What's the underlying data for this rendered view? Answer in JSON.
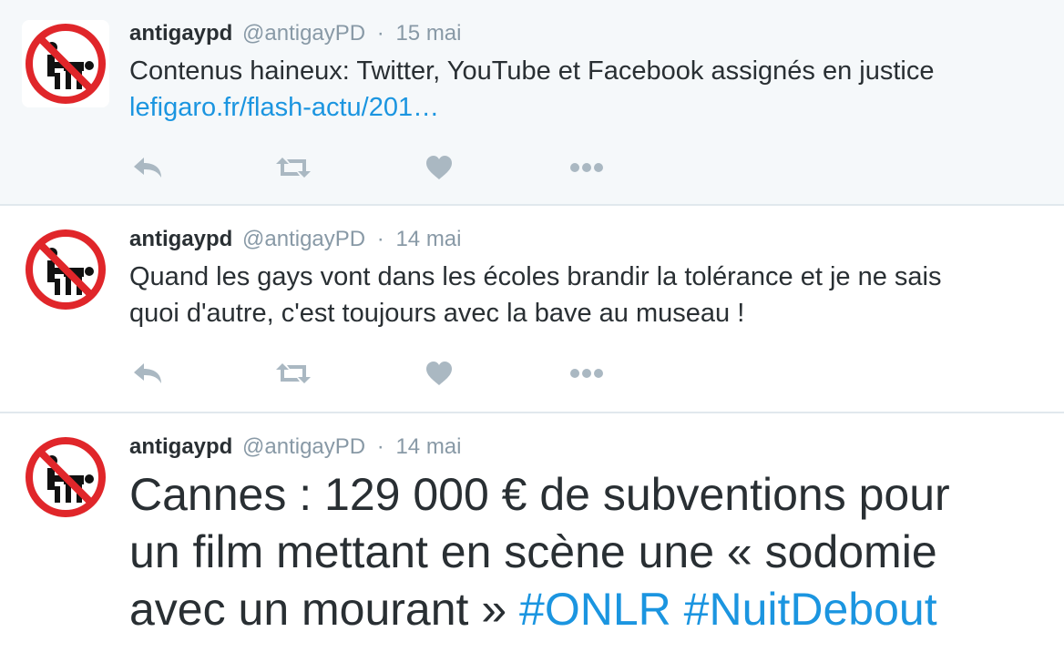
{
  "tweets": [
    {
      "fullname": "antigaypd",
      "username": "@antigayPD",
      "separator": "·",
      "time": "15 mai",
      "text": "Contenus haineux: Twitter, YouTube et Facebook assignés en justice",
      "link": "lefigaro.fr/flash-actu/201…"
    },
    {
      "fullname": "antigaypd",
      "username": "@antigayPD",
      "separator": "·",
      "time": "14 mai",
      "text_line1": "Quand les gays vont dans les écoles brandir la tolérance et je ne sais",
      "text_line2": "quoi d'autre, c'est toujours avec la bave au museau !"
    },
    {
      "fullname": "antigaypd",
      "username": "@antigayPD",
      "separator": "·",
      "time": "14 mai",
      "text_line1": "Cannes : 129 000 € de subventions pour",
      "text_line2": "un film mettant en scène une « sodomie",
      "text_line3_plain": "avec un mourant » ",
      "hashtag1": "#ONLR",
      "hashtag2": "#NuitDebout"
    }
  ],
  "icons": {
    "avatar": "prohibition-sign-icon",
    "reply": "reply-icon",
    "retweet": "retweet-icon",
    "like": "heart-icon",
    "more": "more-dots-icon"
  },
  "colors": {
    "text": "#292f33",
    "muted": "#8899a6",
    "link": "#1b95e0",
    "action_icon": "#aab8c2",
    "highlight_bg": "#f5f8fa",
    "prohibition_red": "#e0262a"
  }
}
